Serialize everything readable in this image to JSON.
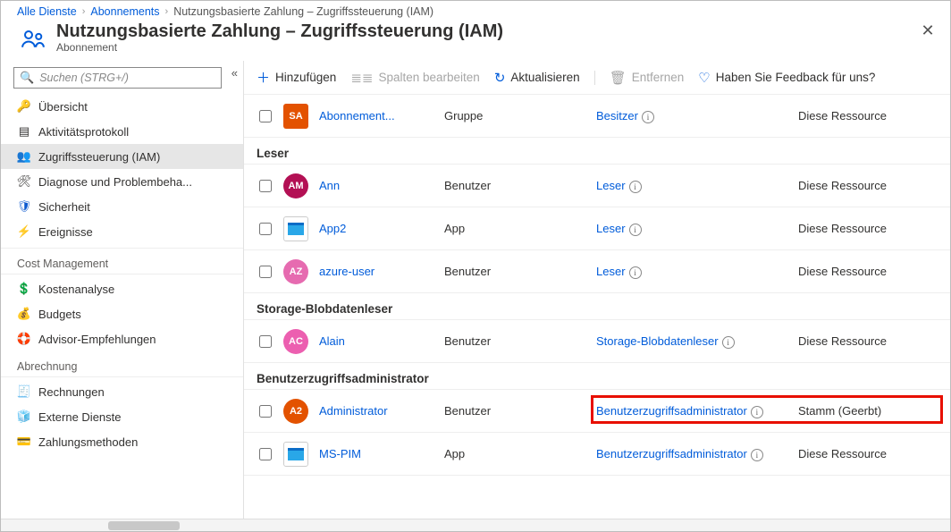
{
  "breadcrumb": {
    "items": [
      "Alle Dienste",
      "Abonnements",
      "Nutzungsbasierte Zahlung – Zugriffssteuerung (IAM)"
    ]
  },
  "header": {
    "title": "Nutzungsbasierte Zahlung – Zugriffssteuerung (IAM)",
    "subtitle": "Abonnement"
  },
  "sidebar": {
    "search_placeholder": "Suchen (STRG+/)",
    "items_top": [
      {
        "icon": "key-gear",
        "label": "Übersicht",
        "color": "#16a34a"
      },
      {
        "icon": "activity-log",
        "label": "Aktivitätsprotokoll",
        "color": "#323130"
      },
      {
        "icon": "people",
        "label": "Zugriffssteuerung (IAM)",
        "color": "#015cda",
        "selected": true
      },
      {
        "icon": "diagnose",
        "label": "Diagnose und Problembeha...",
        "color": "#323130"
      },
      {
        "icon": "shield",
        "label": "Sicherheit",
        "color": "#0c59cf"
      },
      {
        "icon": "bolt",
        "label": "Ereignisse",
        "color": "#f59e0b"
      }
    ],
    "sections": [
      {
        "title": "Cost Management",
        "items": [
          {
            "icon": "cost-analysis",
            "label": "Kostenanalyse",
            "color": "#16a34a"
          },
          {
            "icon": "budgets",
            "label": "Budgets",
            "color": "#015cda"
          },
          {
            "icon": "advisor",
            "label": "Advisor-Empfehlungen",
            "color": "#0aa1dd"
          }
        ]
      },
      {
        "title": "Abrechnung",
        "items": [
          {
            "icon": "invoices",
            "label": "Rechnungen",
            "color": "#323130"
          },
          {
            "icon": "external-services",
            "label": "Externe Dienste",
            "color": "#015cda"
          },
          {
            "icon": "payment-methods",
            "label": "Zahlungsmethoden",
            "color": "#323130"
          }
        ]
      }
    ]
  },
  "toolbar": {
    "add": "Hinzufügen",
    "edit_columns": "Spalten bearbeiten",
    "refresh": "Aktualisieren",
    "remove": "Entfernen",
    "feedback": "Haben Sie Feedback für uns?"
  },
  "rows_pre": [
    {
      "initials": "SA",
      "avatar_bg": "#e35200",
      "square": true,
      "name": "Abonnement...",
      "type": "Gruppe",
      "role": "Besitzer",
      "scope": "Diese Ressource"
    }
  ],
  "groups": [
    {
      "title": "Leser",
      "rows": [
        {
          "initials": "AM",
          "avatar_bg": "#b31054",
          "name": "Ann",
          "type": "Benutzer",
          "role": "Leser",
          "scope": "Diese Ressource"
        },
        {
          "initials": "",
          "avatar_bg": "#29a7e8",
          "square": true,
          "app": true,
          "name": "App2",
          "type": "App",
          "role": "Leser",
          "scope": "Diese Ressource"
        },
        {
          "initials": "AZ",
          "avatar_bg": "#e66bb0",
          "name": "azure-user",
          "type": "Benutzer",
          "role": "Leser",
          "scope": "Diese Ressource"
        }
      ]
    },
    {
      "title": "Storage-Blobdatenleser",
      "rows": [
        {
          "initials": "AC",
          "avatar_bg": "#ec5fb0",
          "name": "Alain",
          "type": "Benutzer",
          "role": "Storage-Blobdatenleser",
          "scope": "Diese Ressource"
        }
      ]
    },
    {
      "title": "Benutzerzugriffsadministrator",
      "rows": [
        {
          "initials": "A2",
          "avatar_bg": "#e35200",
          "name": "Administrator",
          "type": "Benutzer",
          "role": "Benutzerzugriffsadministrator",
          "scope": "Stamm (Geerbt)",
          "highlight": true
        },
        {
          "initials": "",
          "avatar_bg": "#29a7e8",
          "square": true,
          "app": true,
          "name": "MS-PIM",
          "type": "App",
          "role": "Benutzerzugriffsadministrator",
          "scope": "Diese Ressource"
        }
      ]
    }
  ]
}
